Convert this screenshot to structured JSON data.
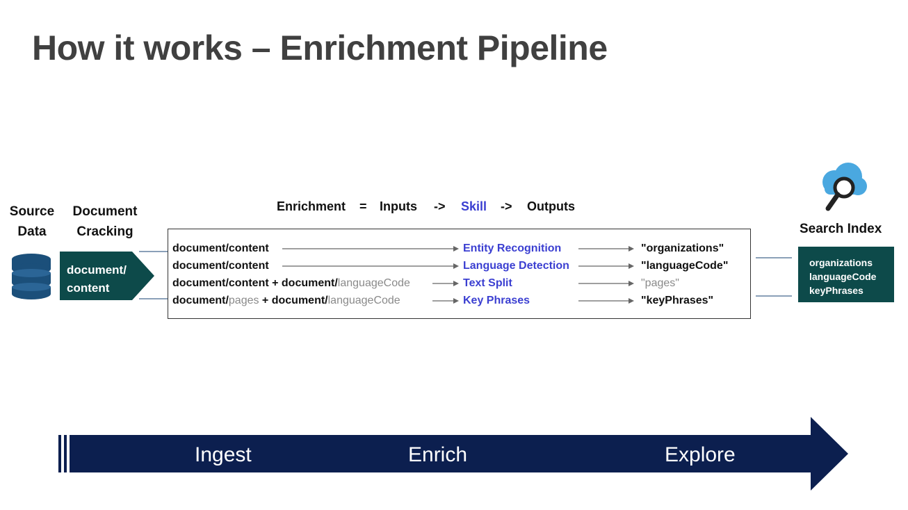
{
  "title": "How it works – Enrichment Pipeline",
  "source_data": {
    "line1": "Source",
    "line2": "Data"
  },
  "document_cracking": {
    "line1": "Document",
    "line2": "Cracking",
    "box_line1": "document/",
    "box_line2": "content"
  },
  "equation": {
    "enrichment": "Enrichment",
    "eq": "=",
    "inputs": "Inputs",
    "arrow1": "->",
    "skill": "Skill",
    "arrow2": "->",
    "outputs": "Outputs"
  },
  "rows": [
    {
      "input_parts": [
        {
          "text": "document/content",
          "style": "blk"
        }
      ],
      "skill": "Entity Recognition",
      "output": "\"organizations\"",
      "output_style": "blk"
    },
    {
      "input_parts": [
        {
          "text": "document/content",
          "style": "blk"
        }
      ],
      "skill": "Language Detection",
      "output": "\"languageCode\"",
      "output_style": "blk"
    },
    {
      "input_parts": [
        {
          "text": "document/content + document/",
          "style": "blk"
        },
        {
          "text": "languageCode",
          "style": "gray"
        }
      ],
      "skill": "Text Split",
      "output": "\"pages\"",
      "output_style": "gray"
    },
    {
      "input_parts": [
        {
          "text": "document/",
          "style": "blk"
        },
        {
          "text": "pages",
          "style": "gray"
        },
        {
          "text": " + document/",
          "style": "blk"
        },
        {
          "text": "languageCode",
          "style": "gray"
        }
      ],
      "skill": "Key Phrases",
      "output": "\"keyPhrases\"",
      "output_style": "blk"
    }
  ],
  "search_index": {
    "label": "Search Index",
    "fields": [
      "organizations",
      "languageCode",
      "keyPhrases"
    ]
  },
  "stages": {
    "ingest": "Ingest",
    "enrich": "Enrich",
    "explore": "Explore"
  },
  "colors": {
    "teal": "#0d4a4a",
    "navy": "#0c1f4f",
    "skill_blue": "#3b3fd1",
    "title_gray": "#404040",
    "cloud_blue": "#4aa8e0"
  },
  "icons": {
    "database": "database-icon",
    "search_cloud": "cloud-search-icon"
  }
}
